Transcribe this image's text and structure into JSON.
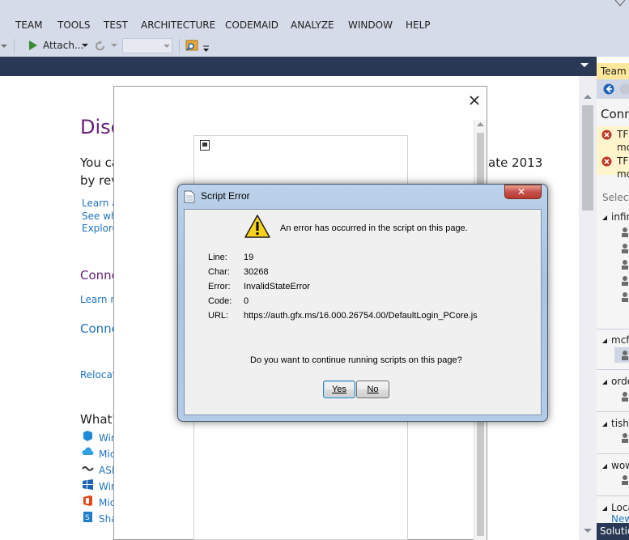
{
  "menu": [
    "TEAM",
    "TOOLS",
    "TEST",
    "ARCHITECTURE",
    "CODEMAID",
    "ANALYZE",
    "WINDOW",
    "HELP"
  ],
  "toolbar": {
    "attach_label": "Attach..."
  },
  "start_page": {
    "heading_partial": "Disc",
    "line1_left": "You ca",
    "line1_right": "ate 2013",
    "line2_left": "by rev",
    "links1": [
      "Learn a",
      "See wha",
      "Explore"
    ],
    "connect1": "Conne",
    "learn_more": "Learn m",
    "connect2": "Conne",
    "relocate": "Relocat",
    "whats_heading": "What'",
    "whats_items": [
      "Win",
      "Mic",
      "ASP",
      "Win",
      "Mic",
      "Sha"
    ]
  },
  "team_panel": {
    "title_partial": "Team I",
    "connect_partial": "Conn",
    "errors": [
      [
        "TF",
        "mo"
      ],
      [
        "TF",
        "mo"
      ]
    ],
    "select_partial": "Select",
    "groups": [
      "infin",
      "mcf",
      "orde",
      "tisha",
      "wow",
      "Loca"
    ],
    "new_link_partial": "New",
    "solution_tab_partial": "Solutio"
  },
  "popup": {
    "close_glyph": "✕"
  },
  "dialog": {
    "title": "Script Error",
    "message": "An error has occurred in the script on this page.",
    "fields": [
      {
        "label": "Line:",
        "value": "19"
      },
      {
        "label": "Char:",
        "value": "30268"
      },
      {
        "label": "Error:",
        "value": "InvalidStateError"
      },
      {
        "label": "Code:",
        "value": "0"
      },
      {
        "label": "URL:",
        "value": "https://auth.gfx.ms/16.000.26754.00/DefaultLogin_PCore.js"
      }
    ],
    "question": "Do you want to continue running scripts on this page?",
    "yes_label": "Yes",
    "no_label": "No",
    "close_glyph": "✕"
  },
  "colors": {
    "vs_chrome": "#d6dbe9",
    "vs_dark": "#293955",
    "link_blue": "#1e73be",
    "accent_purple": "#68217a",
    "close_red": "#c75050",
    "error_red": "#c0392b"
  }
}
